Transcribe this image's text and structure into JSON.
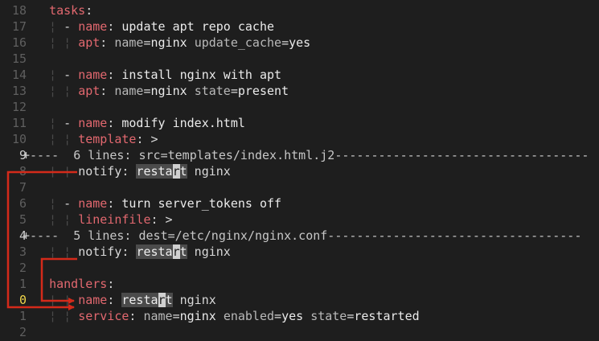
{
  "editor": {
    "lines": [
      {
        "num": "18",
        "segs": [
          {
            "c": "t",
            "t": "  "
          },
          {
            "c": "k",
            "t": "tasks"
          },
          {
            "c": "t",
            "t": ":"
          }
        ]
      },
      {
        "num": "17",
        "segs": [
          {
            "c": "g",
            "t": "  ¦ "
          },
          {
            "c": "t",
            "t": "- "
          },
          {
            "c": "k",
            "t": "name"
          },
          {
            "c": "t",
            "t": ": "
          },
          {
            "c": "v",
            "t": "update apt repo cache"
          }
        ]
      },
      {
        "num": "16",
        "segs": [
          {
            "c": "g",
            "t": "  ¦ ¦ "
          },
          {
            "c": "k",
            "t": "apt"
          },
          {
            "c": "t",
            "t": ": "
          },
          {
            "c": "a",
            "t": "name"
          },
          {
            "c": "t",
            "t": "="
          },
          {
            "c": "v",
            "t": "nginx "
          },
          {
            "c": "a",
            "t": "update_cache"
          },
          {
            "c": "t",
            "t": "="
          },
          {
            "c": "v",
            "t": "yes"
          }
        ]
      },
      {
        "num": "15",
        "segs": []
      },
      {
        "num": "14",
        "segs": [
          {
            "c": "g",
            "t": "  ¦ "
          },
          {
            "c": "t",
            "t": "- "
          },
          {
            "c": "k",
            "t": "name"
          },
          {
            "c": "t",
            "t": ": "
          },
          {
            "c": "v",
            "t": "install nginx with apt"
          }
        ]
      },
      {
        "num": "13",
        "segs": [
          {
            "c": "g",
            "t": "  ¦ ¦ "
          },
          {
            "c": "k",
            "t": "apt"
          },
          {
            "c": "t",
            "t": ": "
          },
          {
            "c": "a",
            "t": "name"
          },
          {
            "c": "t",
            "t": "="
          },
          {
            "c": "v",
            "t": "nginx "
          },
          {
            "c": "a",
            "t": "state"
          },
          {
            "c": "t",
            "t": "="
          },
          {
            "c": "v",
            "t": "present"
          }
        ]
      },
      {
        "num": "12",
        "segs": []
      },
      {
        "num": "11",
        "segs": [
          {
            "c": "g",
            "t": "  ¦ "
          },
          {
            "c": "t",
            "t": "- "
          },
          {
            "c": "k",
            "t": "name"
          },
          {
            "c": "t",
            "t": ": "
          },
          {
            "c": "v",
            "t": "modify index.html"
          }
        ]
      },
      {
        "num": "10",
        "segs": [
          {
            "c": "g",
            "t": "  ¦ ¦ "
          },
          {
            "c": "k",
            "t": "template"
          },
          {
            "c": "t",
            "t": ": >"
          }
        ]
      },
      {
        "num": "9",
        "fold": true,
        "numcol": "#cfcfcf",
        "segs": [
          {
            "c": "f",
            "t": "+----  6 lines: src=templates/index.html.j2-----------------------------------"
          }
        ]
      },
      {
        "num": "8",
        "segs": [
          {
            "c": "g",
            "t": "  ¦ ¦ "
          },
          {
            "c": "t",
            "t": "notify: "
          },
          {
            "c": "hl",
            "t": "resta"
          },
          {
            "c": "cursor",
            "t": "r"
          },
          {
            "c": "hl",
            "t": "t"
          },
          {
            "c": "t",
            "t": " nginx"
          }
        ]
      },
      {
        "num": "7",
        "segs": []
      },
      {
        "num": "6",
        "segs": [
          {
            "c": "g",
            "t": "  ¦ "
          },
          {
            "c": "t",
            "t": "- "
          },
          {
            "c": "k",
            "t": "name"
          },
          {
            "c": "t",
            "t": ": "
          },
          {
            "c": "v",
            "t": "turn server_tokens off"
          }
        ]
      },
      {
        "num": "5",
        "segs": [
          {
            "c": "g",
            "t": "  ¦ ¦ "
          },
          {
            "c": "k",
            "t": "lineinfile"
          },
          {
            "c": "t",
            "t": ": >"
          }
        ]
      },
      {
        "num": "4",
        "fold": true,
        "numcol": "#cfcfcf",
        "segs": [
          {
            "c": "f",
            "t": "+----  5 lines: dest=/etc/nginx/nginx.conf-----------------------------------"
          }
        ]
      },
      {
        "num": "3",
        "segs": [
          {
            "c": "g",
            "t": "  ¦ ¦ "
          },
          {
            "c": "t",
            "t": "notify: "
          },
          {
            "c": "hl",
            "t": "resta"
          },
          {
            "c": "cursor",
            "t": "r"
          },
          {
            "c": "hl",
            "t": "t"
          },
          {
            "c": "t",
            "t": " nginx"
          }
        ]
      },
      {
        "num": "2",
        "segs": []
      },
      {
        "num": "1",
        "segs": [
          {
            "c": "t",
            "t": "  "
          },
          {
            "c": "k",
            "t": "handlers"
          },
          {
            "c": "t",
            "t": ":"
          }
        ]
      },
      {
        "num": "0",
        "current": true,
        "segs": [
          {
            "c": "g",
            "t": "  ¦ ¦ "
          },
          {
            "c": "k",
            "t": "name"
          },
          {
            "c": "t",
            "t": ": "
          },
          {
            "c": "hl",
            "t": "resta"
          },
          {
            "c": "cursor",
            "t": "r"
          },
          {
            "c": "hl",
            "t": "t"
          },
          {
            "c": "t",
            "t": " nginx"
          }
        ]
      },
      {
        "num": "1",
        "segs": [
          {
            "c": "g",
            "t": "  ¦ ¦ "
          },
          {
            "c": "k",
            "t": "service"
          },
          {
            "c": "t",
            "t": ": "
          },
          {
            "c": "a",
            "t": "name"
          },
          {
            "c": "t",
            "t": "="
          },
          {
            "c": "v",
            "t": "nginx "
          },
          {
            "c": "a",
            "t": "enabled"
          },
          {
            "c": "t",
            "t": "="
          },
          {
            "c": "v",
            "t": "yes "
          },
          {
            "c": "a",
            "t": "state"
          },
          {
            "c": "t",
            "t": "="
          },
          {
            "c": "v",
            "t": "restarted"
          }
        ]
      },
      {
        "num": "2",
        "segs": []
      }
    ]
  },
  "colors": {
    "background": "#1e1e1e",
    "key": "#e2686f",
    "current_line_number": "#f1d74a",
    "arrow": "#d42a1a"
  }
}
